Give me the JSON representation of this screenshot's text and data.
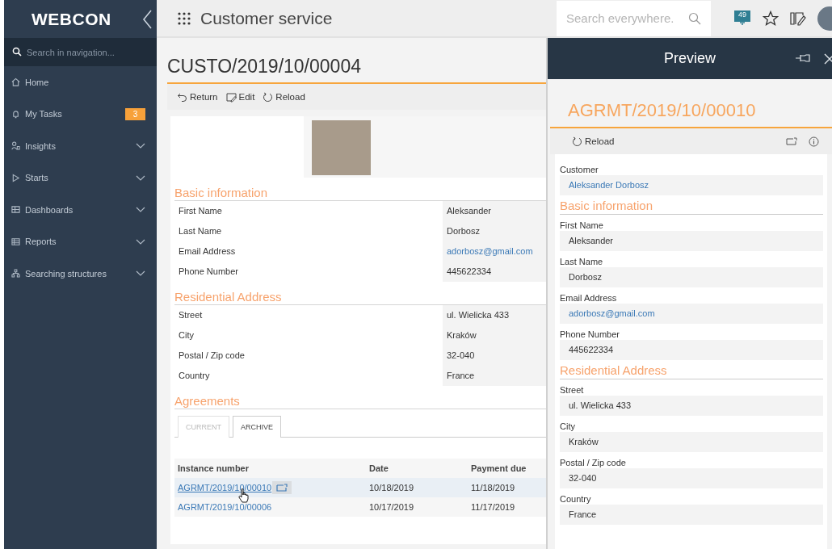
{
  "sidebar": {
    "logo": "WEBCON",
    "search": {
      "placeholder": "Search in navigation..."
    },
    "items": [
      {
        "label": "Home",
        "expandable": false
      },
      {
        "label": "My Tasks",
        "expandable": false,
        "badge": "3"
      },
      {
        "label": "Insights",
        "expandable": true
      },
      {
        "label": "Starts",
        "expandable": true
      },
      {
        "label": "Dashboards",
        "expandable": true
      },
      {
        "label": "Reports",
        "expandable": true
      },
      {
        "label": "Searching structures",
        "expandable": true
      }
    ]
  },
  "topbar": {
    "title": "Customer service",
    "search": {
      "placeholder": "Search everywhere."
    },
    "notifications": "49"
  },
  "form": {
    "title": "CUSTO/2019/10/00004",
    "toolbar": [
      "Return",
      "Edit",
      "Reload"
    ],
    "sections": [
      {
        "heading": "Basic information",
        "fields": [
          {
            "label": "First Name",
            "value": "Aleksander",
            "kind": "text"
          },
          {
            "label": "Last Name",
            "value": "Dorbosz",
            "kind": "text"
          },
          {
            "label": "Email Address",
            "value": "adorbosz@gmail.com",
            "kind": "link"
          },
          {
            "label": "Phone Number",
            "value": "445622334",
            "kind": "text"
          }
        ]
      },
      {
        "heading": "Residential Address",
        "fields": [
          {
            "label": "Street",
            "value": "ul. Wielicka 433",
            "kind": "text"
          },
          {
            "label": "City",
            "value": "Kraków",
            "kind": "text"
          },
          {
            "label": "Postal / Zip code",
            "value": "32-040",
            "kind": "text"
          },
          {
            "label": "Country",
            "value": "France",
            "kind": "text"
          }
        ]
      }
    ],
    "agreements": {
      "heading": "Agreements",
      "tabs": [
        {
          "label": "CURRENT",
          "selected": false
        },
        {
          "label": "ARCHIVE",
          "selected": true
        }
      ],
      "columns": [
        "Instance number",
        "Date",
        "Payment due"
      ],
      "rows": [
        {
          "selected": true,
          "cells": [
            "AGRMT/2019/10/00010",
            "10/18/2019",
            "11/18/2019"
          ]
        },
        {
          "selected": false,
          "cells": [
            "AGRMT/2019/10/00006",
            "10/17/2019",
            "11/17/2019"
          ]
        }
      ]
    }
  },
  "preview": {
    "header": "Preview",
    "title": "AGRMT/2019/10/00010",
    "toolbar": [
      "Reload"
    ],
    "items": [
      {
        "kind": "field",
        "label": "Customer",
        "value": "Aleksander Dorbosz",
        "link": true
      },
      {
        "kind": "heading",
        "label": "Basic information"
      },
      {
        "kind": "field",
        "label": "First Name",
        "value": "Aleksander",
        "link": false
      },
      {
        "kind": "field",
        "label": "Last Name",
        "value": "Dorbosz",
        "link": false
      },
      {
        "kind": "field",
        "label": "Email Address",
        "value": "adorbosz@gmail.com",
        "link": true
      },
      {
        "kind": "field",
        "label": "Phone Number",
        "value": "445622334",
        "link": false
      },
      {
        "kind": "heading",
        "label": "Residential Address"
      },
      {
        "kind": "field",
        "label": "Street",
        "value": "ul. Wielicka 433",
        "link": false
      },
      {
        "kind": "field",
        "label": "City",
        "value": "Kraków",
        "link": false
      },
      {
        "kind": "field",
        "label": "Postal / Zip code",
        "value": "32-040",
        "link": false
      },
      {
        "kind": "field",
        "label": "Country",
        "value": "France",
        "link": false
      }
    ]
  }
}
